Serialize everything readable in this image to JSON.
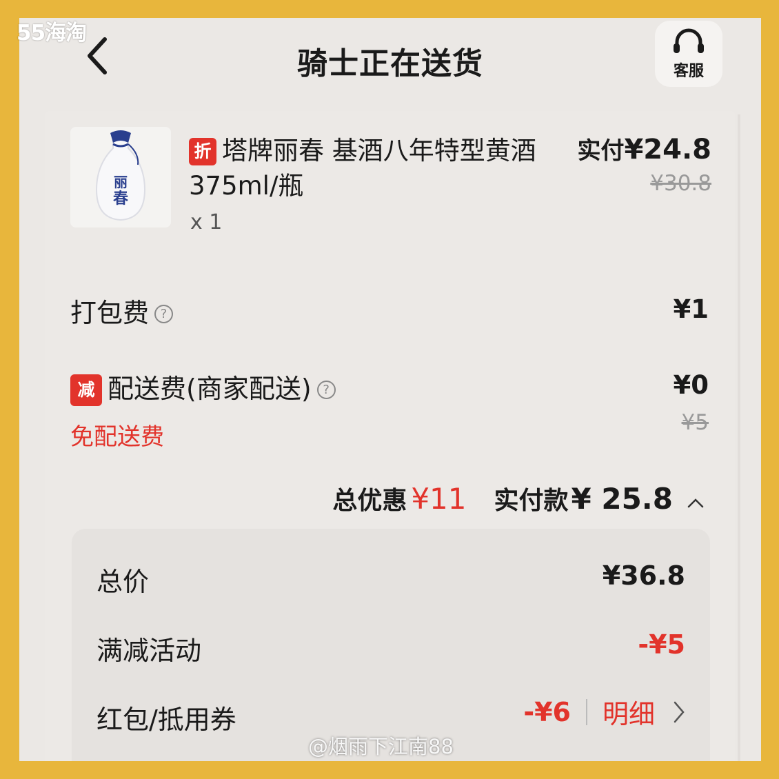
{
  "watermark": {
    "top": "55海淘",
    "bottom": "@烟雨下江南88"
  },
  "header": {
    "title": "骑士正在送货",
    "service_label": "客服"
  },
  "product": {
    "tag": "折",
    "name": "塔牌丽春 基酒八年特型黄酒 375ml/瓶",
    "qty": "x 1",
    "paid_label": "实付",
    "paid_price": "¥24.8",
    "orig_price": "¥30.8",
    "thumb_text": "丽春"
  },
  "fees": {
    "packing_label": "打包费",
    "packing_value": "¥1",
    "delivery_tag": "减",
    "delivery_label": "配送费(商家配送)",
    "delivery_value": "¥0",
    "delivery_orig": "¥5",
    "free_delivery": "免配送费"
  },
  "summary": {
    "discount_label": "总优惠",
    "discount_value": "¥11",
    "paid_label": "实付款",
    "paid_value": "¥ 25.8"
  },
  "detail": {
    "total_label": "总价",
    "total_value": "¥36.8",
    "promo_label": "满减活动",
    "promo_value": "-¥5",
    "coupon_label": "红包/抵用券",
    "coupon_value": "-¥6",
    "detail_link": "明细"
  },
  "colors": {
    "accent": "#e2332b",
    "frame": "#e8b63c",
    "background": "#ebe8e5"
  }
}
